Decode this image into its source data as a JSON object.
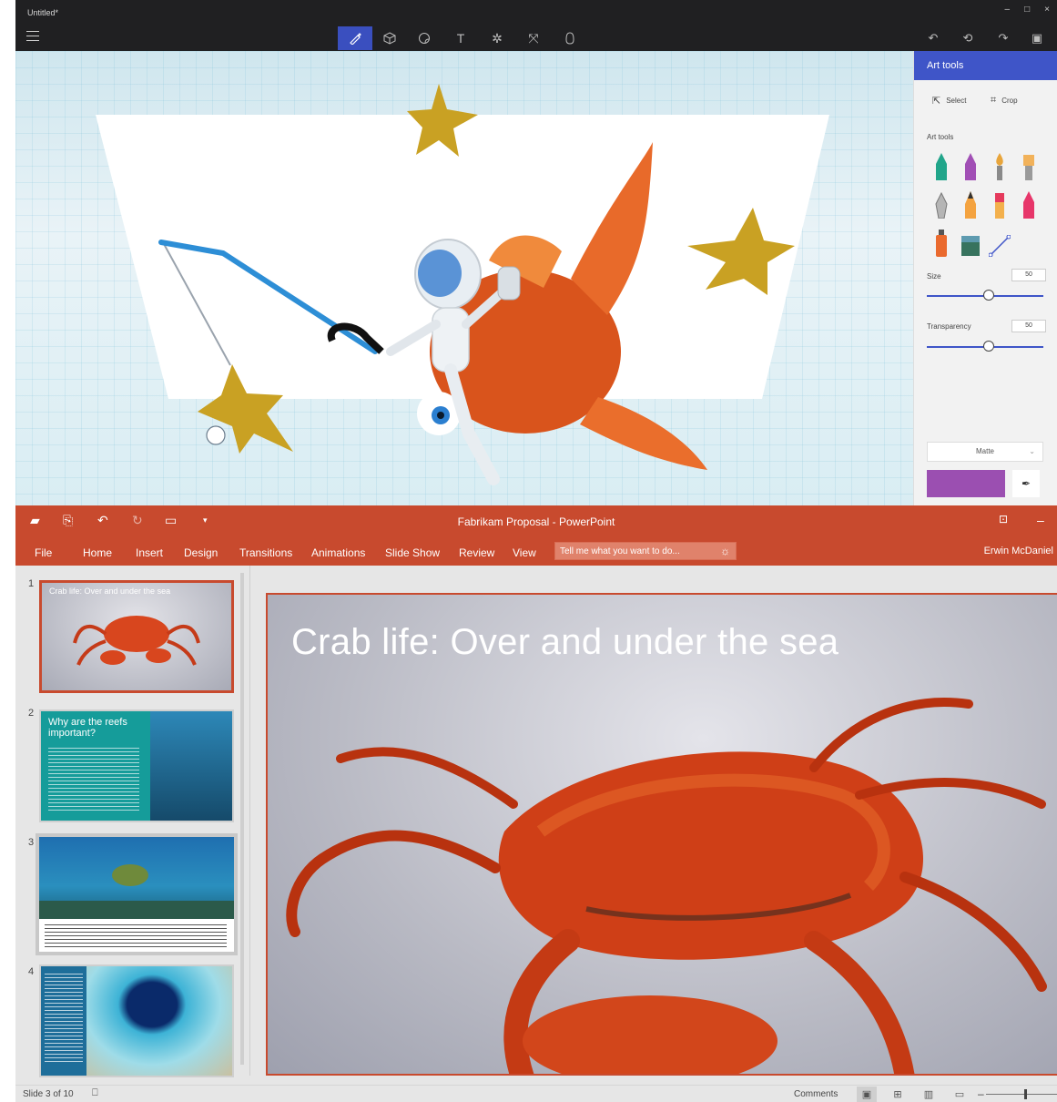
{
  "paint3d": {
    "window_title": "Untitled*",
    "window_controls": [
      "–",
      "□",
      "×"
    ],
    "toolbar_icons": [
      "menu-icon",
      "brush-icon",
      "3d-shapes-icon",
      "stickers-icon",
      "text-icon",
      "effects-icon",
      "canvas-icon",
      "3d-library-icon"
    ],
    "right_icons": [
      "undo-icon",
      "history-icon",
      "redo-icon",
      "paste-icon"
    ],
    "panel": {
      "header": "Art tools",
      "select_label": "Select",
      "crop_label": "Crop",
      "section_label": "Art tools",
      "tools": [
        {
          "name": "marker",
          "color": "#21a58a"
        },
        {
          "name": "calligraphy-pen",
          "color": "#a14fb5"
        },
        {
          "name": "oil-brush",
          "color": "#e8a53b"
        },
        {
          "name": "watercolor",
          "color": "#f2b25a"
        },
        {
          "name": "pixel-pen",
          "color": "#9e9e9e"
        },
        {
          "name": "pencil",
          "color": "#f4a340"
        },
        {
          "name": "eraser",
          "color": "#e53a5c"
        },
        {
          "name": "crayon",
          "color": "#e7366a"
        },
        {
          "name": "spray-can",
          "color": "#ea6a2e"
        },
        {
          "name": "fill",
          "color": "#37735e"
        },
        {
          "name": "line",
          "color": "#3f55c8"
        }
      ],
      "size_label": "Size",
      "size_value": "50",
      "transparency_label": "Transparency",
      "transparency_value": "50",
      "finish_label": "Matte",
      "selected_color": "#9b4fb1"
    }
  },
  "powerpoint": {
    "window_title": "Fabrikam Proposal - PowerPoint",
    "ribbon_tabs": [
      "File",
      "Home",
      "Insert",
      "Design",
      "Transitions",
      "Animations",
      "Slide Show",
      "Review",
      "View"
    ],
    "tell_me_placeholder": "Tell me what you want to do...",
    "user_name": "Erwin McDaniel",
    "slides": [
      {
        "number": "1",
        "title": "Crab life: Over and under the sea"
      },
      {
        "number": "2",
        "title": "Why are the reefs important?"
      },
      {
        "number": "3",
        "title": ""
      },
      {
        "number": "4",
        "title": ""
      }
    ],
    "current_slide_title": "Crab life: Over and under the sea",
    "status": {
      "slide_indicator": "Slide 3 of 10",
      "comments_label": "Comments",
      "zoom_minus": "–"
    }
  }
}
